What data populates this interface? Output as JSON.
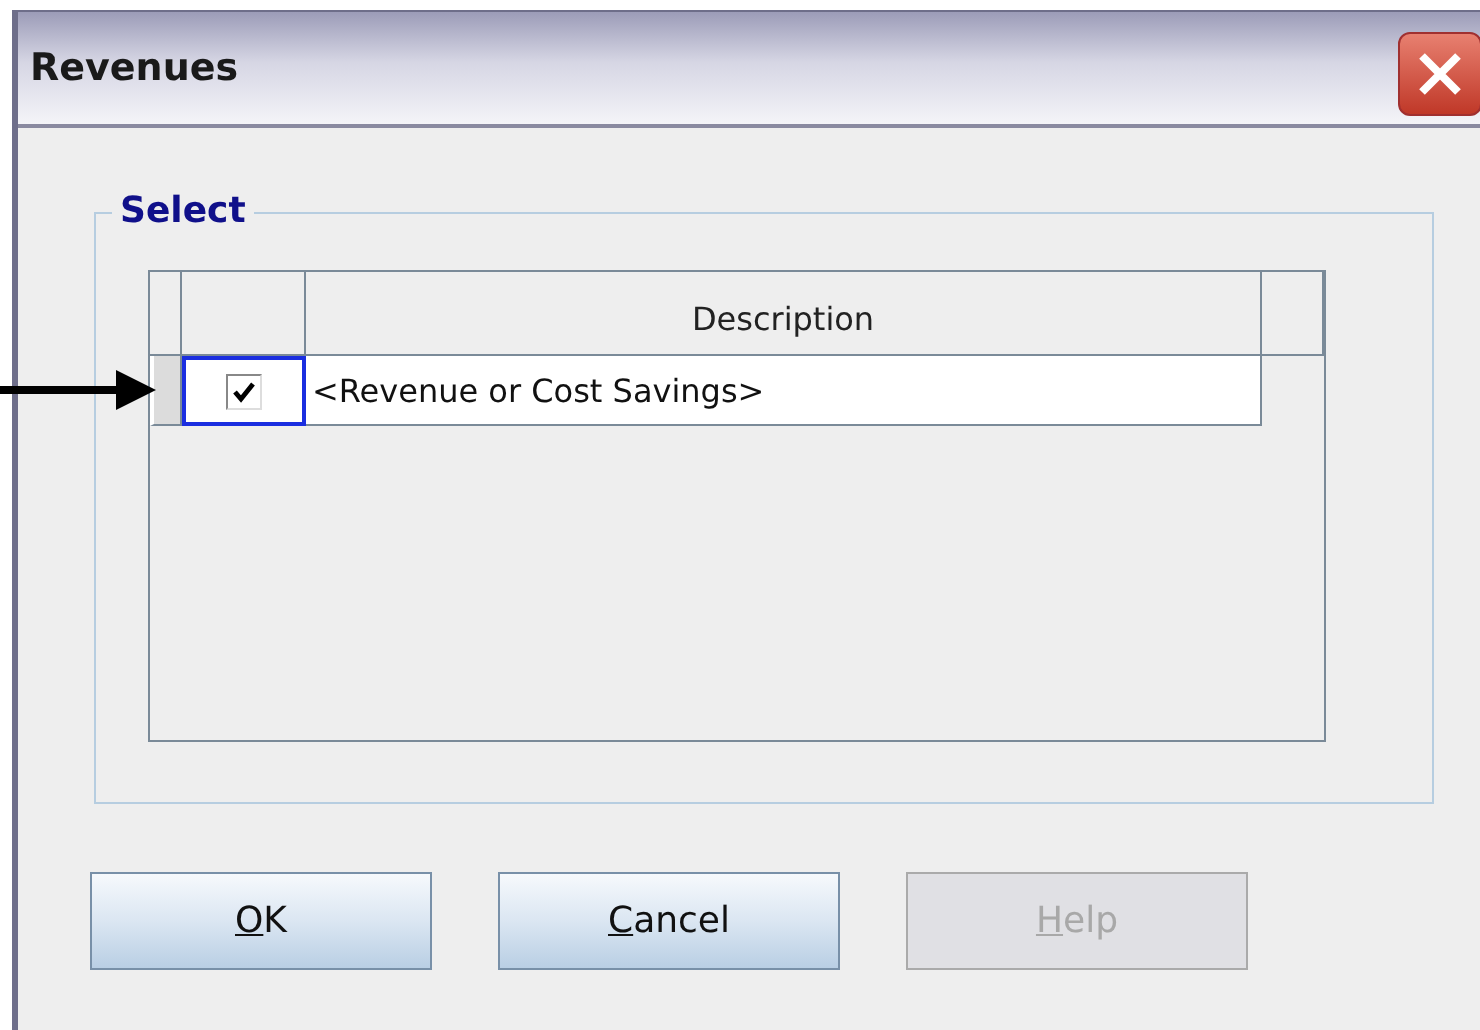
{
  "window": {
    "title": "Revenues"
  },
  "group": {
    "title": "Select"
  },
  "table": {
    "columns": [
      "Description"
    ],
    "rows": [
      {
        "checked": true,
        "selected": true,
        "description": "<Revenue or Cost Savings>"
      }
    ]
  },
  "buttons": [
    {
      "mnemonic": "O",
      "rest": "K",
      "disabled": false
    },
    {
      "mnemonic": "C",
      "rest": "ancel",
      "disabled": false
    },
    {
      "mnemonic": "H",
      "rest": "elp",
      "disabled": true
    }
  ]
}
